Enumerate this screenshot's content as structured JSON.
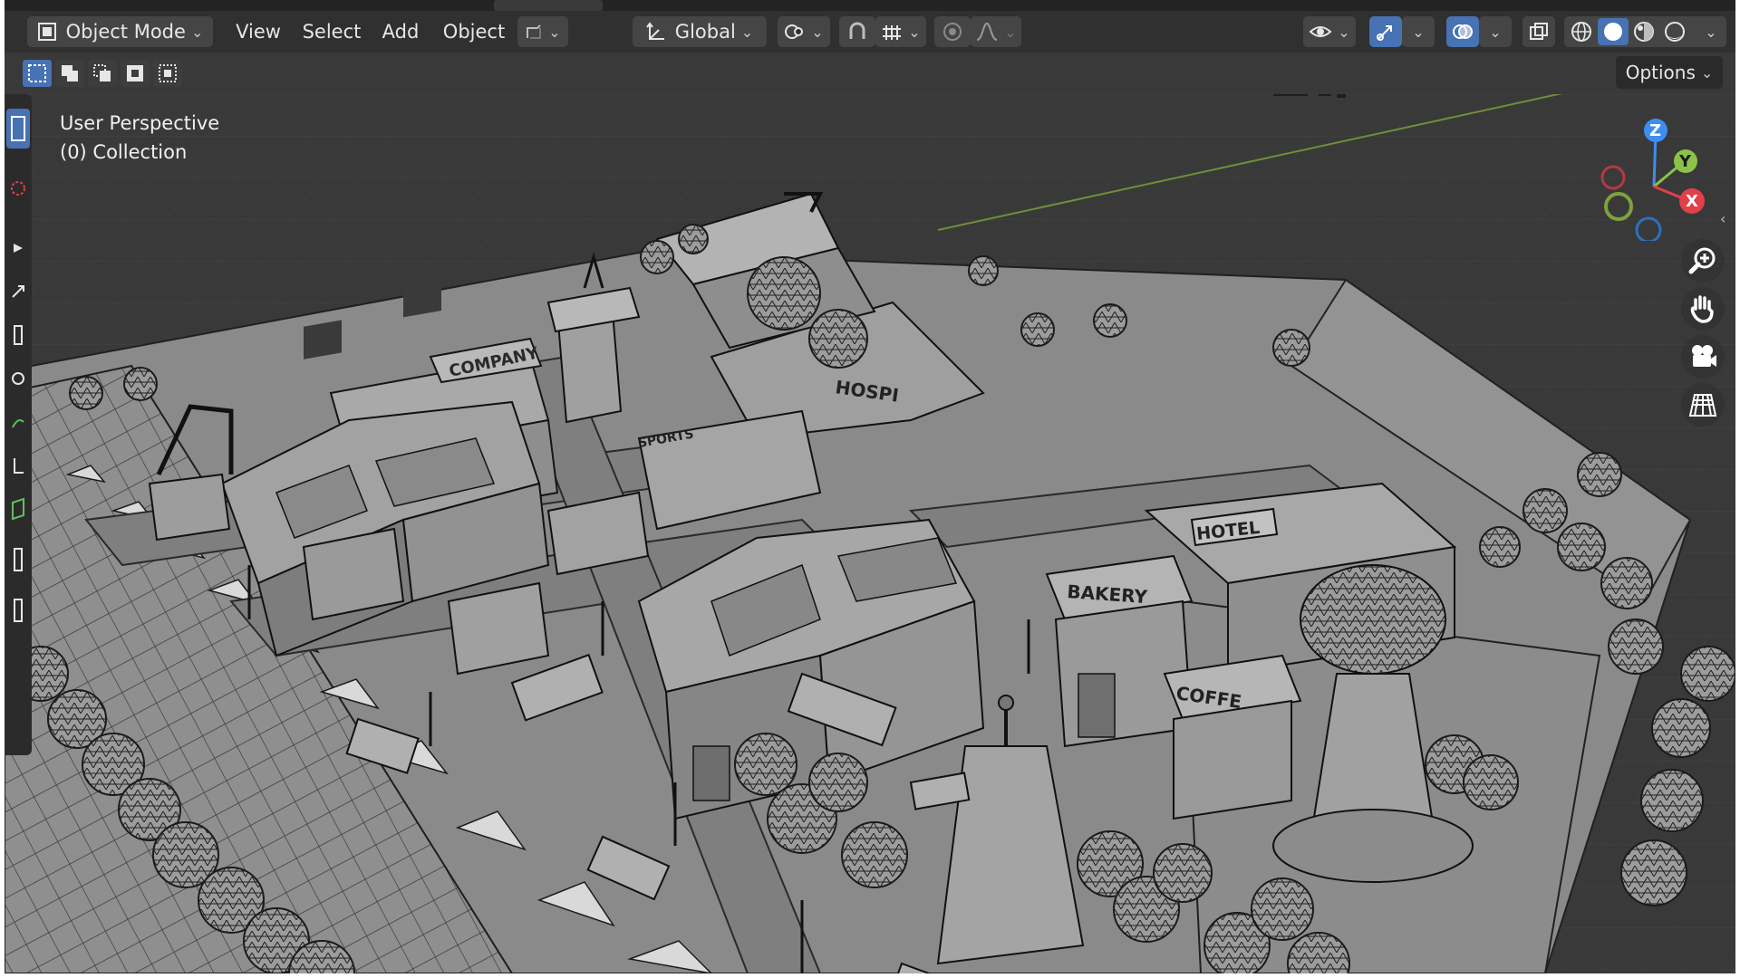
{
  "header": {
    "mode_label": "Object Mode",
    "menus": [
      "View",
      "Select",
      "Add",
      "Object"
    ],
    "transform_orientation": "Global"
  },
  "toolbar": {
    "options_label": "Options"
  },
  "viewport": {
    "view_name": "User Perspective",
    "collection": "(0) Collection"
  },
  "gizmo": {
    "z_label": "Z",
    "y_label": "Y",
    "x_label": "X"
  },
  "colors": {
    "accent": "#4772b3",
    "header_bg": "#303030",
    "viewport_bg": "#393939",
    "axis_x": "#e0404a",
    "axis_y": "#8bc34a",
    "axis_z": "#3d8ef0"
  },
  "icons": [
    "object-mode-icon",
    "snap-icon",
    "proportional-edit-icon",
    "visibility-icon",
    "gizmo-icon",
    "overlay-icon",
    "xray-icon",
    "wireframe-shading-icon",
    "solid-shading-icon",
    "material-shading-icon",
    "rendered-shading-icon",
    "zoom-icon",
    "pan-hand-icon",
    "camera-icon",
    "grid-icon"
  ]
}
